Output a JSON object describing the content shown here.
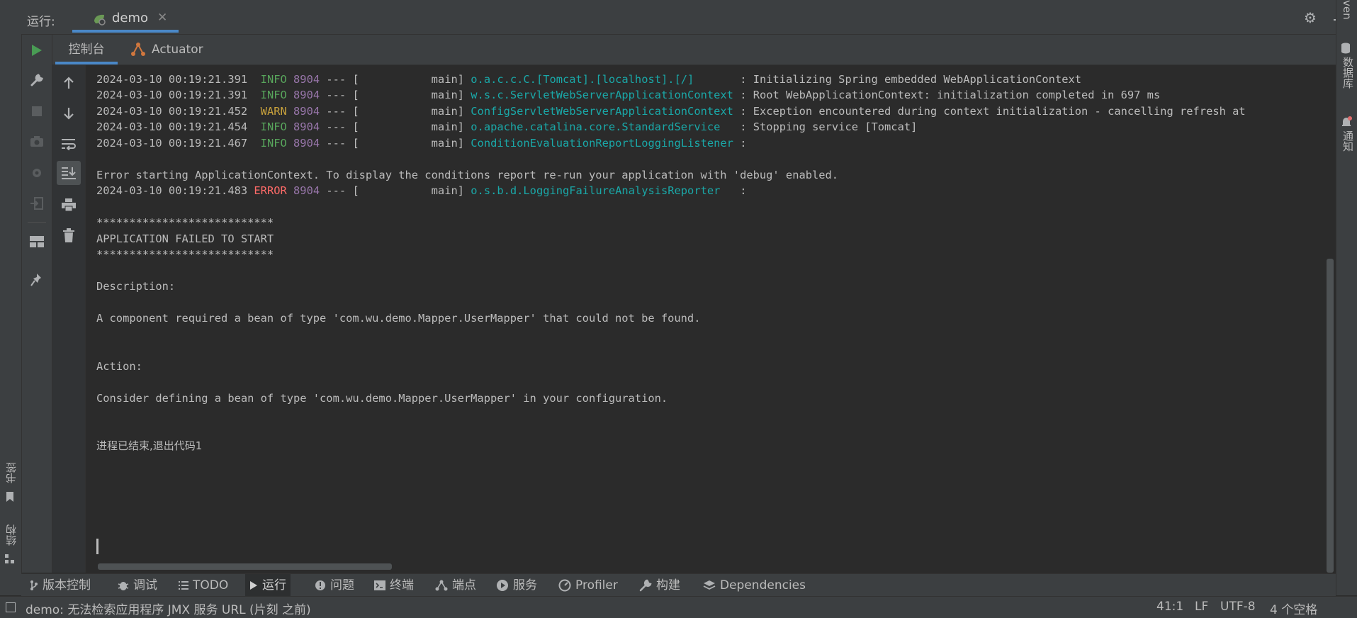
{
  "run_header": {
    "label": "运行:",
    "tab_label": "demo",
    "close_glyph": "✕",
    "gear_glyph": "⚙"
  },
  "inner_tabs": {
    "console": "控制台",
    "actuator": "Actuator"
  },
  "console": {
    "lines": [
      {
        "ts": "2024-03-10 00:19:21.391",
        "level": "INFO",
        "pid": "8904",
        "sep": "--- [",
        "thread": "           main]",
        "logger": "o.a.c.c.C.[Tomcat].[localhost].[/]      ",
        "msg": " : Initializing Spring embedded WebApplicationContext"
      },
      {
        "ts": "2024-03-10 00:19:21.391",
        "level": "INFO",
        "pid": "8904",
        "sep": "--- [",
        "thread": "           main]",
        "logger": "w.s.c.ServletWebServerApplicationContext",
        "msg": " : Root WebApplicationContext: initialization completed in 697 ms"
      },
      {
        "ts": "2024-03-10 00:19:21.452",
        "level": "WARN",
        "pid": "8904",
        "sep": "--- [",
        "thread": "           main]",
        "logger": "ConfigServletWebServerApplicationContext",
        "msg": " : Exception encountered during context initialization - cancelling refresh at"
      },
      {
        "ts": "2024-03-10 00:19:21.454",
        "level": "INFO",
        "pid": "8904",
        "sep": "--- [",
        "thread": "           main]",
        "logger": "o.apache.catalina.core.StandardService  ",
        "msg": " : Stopping service [Tomcat]"
      },
      {
        "ts": "2024-03-10 00:19:21.467",
        "level": "INFO",
        "pid": "8904",
        "sep": "--- [",
        "thread": "           main]",
        "logger": "ConditionEvaluationReportLoggingListener",
        "msg": " :"
      }
    ],
    "error_starting": "Error starting ApplicationContext. To display the conditions report re-run your application with 'debug' enabled.",
    "error_line": {
      "ts": "2024-03-10 00:19:21.483",
      "level": "ERROR",
      "pid": "8904",
      "sep": "--- [",
      "thread": "           main]",
      "logger": "o.s.b.d.LoggingFailureAnalysisReporter  ",
      "msg": " :"
    },
    "stars": "***************************",
    "failed": "APPLICATION FAILED TO START",
    "description_label": "Description:",
    "description": "A component required a bean of type 'com.wu.demo.Mapper.UserMapper' that could not be found.",
    "action_label": "Action:",
    "action": "Consider defining a bean of type 'com.wu.demo.Mapper.UserMapper' in your configuration.",
    "exit": "进程已结束,退出代码1"
  },
  "left_stripe": {
    "bookmarks": "书签",
    "structure": "结构"
  },
  "right_stripe": {
    "maven": "ven",
    "database": "数据库",
    "notifications": "通知"
  },
  "bottom_tools": [
    {
      "label": "版本控制",
      "icon": "branch-icon"
    },
    {
      "label": "调试",
      "icon": "bug-icon"
    },
    {
      "label": "TODO",
      "icon": "list-icon"
    },
    {
      "label": "运行",
      "icon": "run-icon"
    },
    {
      "label": "问题",
      "icon": "problems-icon"
    },
    {
      "label": "终端",
      "icon": "terminal-icon"
    },
    {
      "label": "端点",
      "icon": "endpoints-icon"
    },
    {
      "label": "服务",
      "icon": "services-icon"
    },
    {
      "label": "Profiler",
      "icon": "profiler-icon"
    },
    {
      "label": "构建",
      "icon": "build-icon"
    },
    {
      "label": "Dependencies",
      "icon": "dependencies-icon"
    }
  ],
  "status_bar": {
    "message": "demo: 无法检索应用程序 JMX 服务 URL (片刻 之前)",
    "position": "41:1",
    "line_sep": "LF",
    "encoding": "UTF-8",
    "indent": "4 个空格"
  },
  "colors": {
    "accent": "#4a88c7",
    "info": "#58a65c",
    "warn": "#c9a23c",
    "error": "#ff6b68",
    "pid": "#9876aa",
    "logger": "#1aa8a8",
    "run_green": "#499c54"
  }
}
